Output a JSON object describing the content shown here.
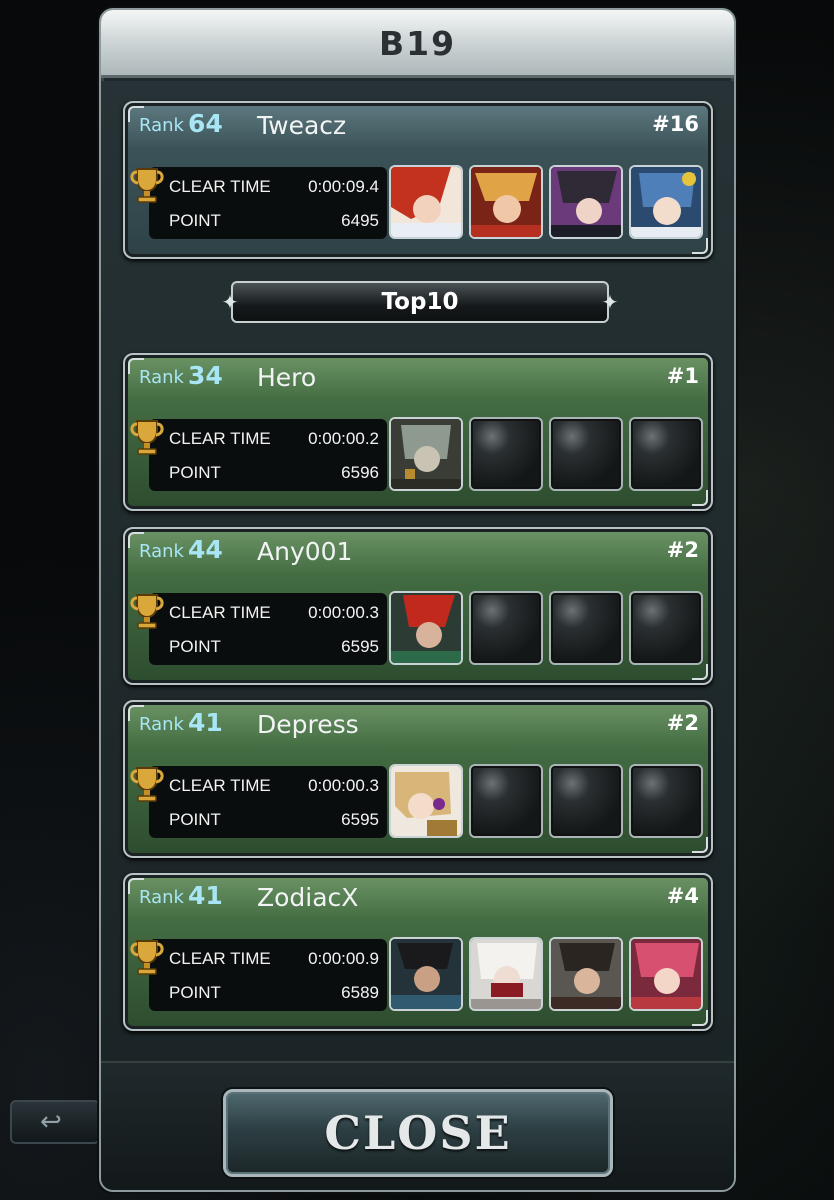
{
  "header": {
    "title": "B19"
  },
  "labels": {
    "rank": "Rank",
    "clear_time": "CLEAR TIME",
    "point": "POINT"
  },
  "my_entry": {
    "rank": "64",
    "name": "Tweacz",
    "place": "#16",
    "clear_time": "0:00:09.4",
    "point": "6495",
    "party": [
      "hero-red-hair",
      "hero-blonde",
      "hero-dark-hair",
      "hero-blue-hair"
    ]
  },
  "divider": {
    "label": "Top10"
  },
  "top_entries": [
    {
      "rank": "34",
      "name": "Hero",
      "place": "#1",
      "clear_time": "0:00:00.2",
      "point": "6596",
      "party": [
        "hero-armored-beast",
        null,
        null,
        null
      ]
    },
    {
      "rank": "44",
      "name": "Any001",
      "place": "#2",
      "clear_time": "0:00:00.3",
      "point": "6595",
      "party": [
        "hero-red-warrior",
        null,
        null,
        null
      ]
    },
    {
      "rank": "41",
      "name": "Depress",
      "place": "#2",
      "clear_time": "0:00:00.3",
      "point": "6595",
      "party": [
        "hero-blonde-mage",
        null,
        null,
        null
      ]
    },
    {
      "rank": "41",
      "name": "ZodiacX",
      "place": "#4",
      "clear_time": "0:00:00.9",
      "point": "6589",
      "party": [
        "hero-samurai",
        "hero-masked",
        "hero-swordsman",
        "hero-pink-hair"
      ]
    }
  ],
  "footer": {
    "close_label": "CLOSE"
  },
  "background": {
    "back_button_glyph": "↩"
  }
}
